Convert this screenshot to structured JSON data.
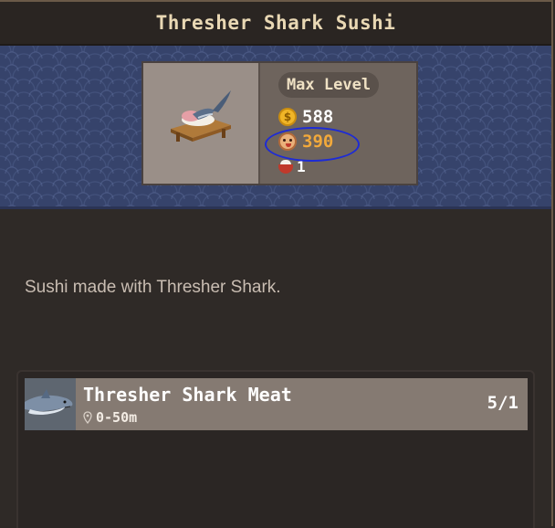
{
  "title": "Thresher Shark Sushi",
  "item": {
    "level_label": "Max Level",
    "price": "588",
    "taste": "390",
    "bowl_count": "1",
    "thumb_icon": "shark-sushi-icon"
  },
  "description": "Sushi made with Thresher Shark.",
  "ingredients": [
    {
      "name": "Thresher Shark Meat",
      "location": "0-50m",
      "count": "5/1",
      "icon": "thresher-shark-icon"
    }
  ],
  "colors": {
    "banner": "#36436b",
    "card": "#6e645d",
    "taste_value": "#f2a93b",
    "highlight_circle": "#1d2bd6"
  }
}
